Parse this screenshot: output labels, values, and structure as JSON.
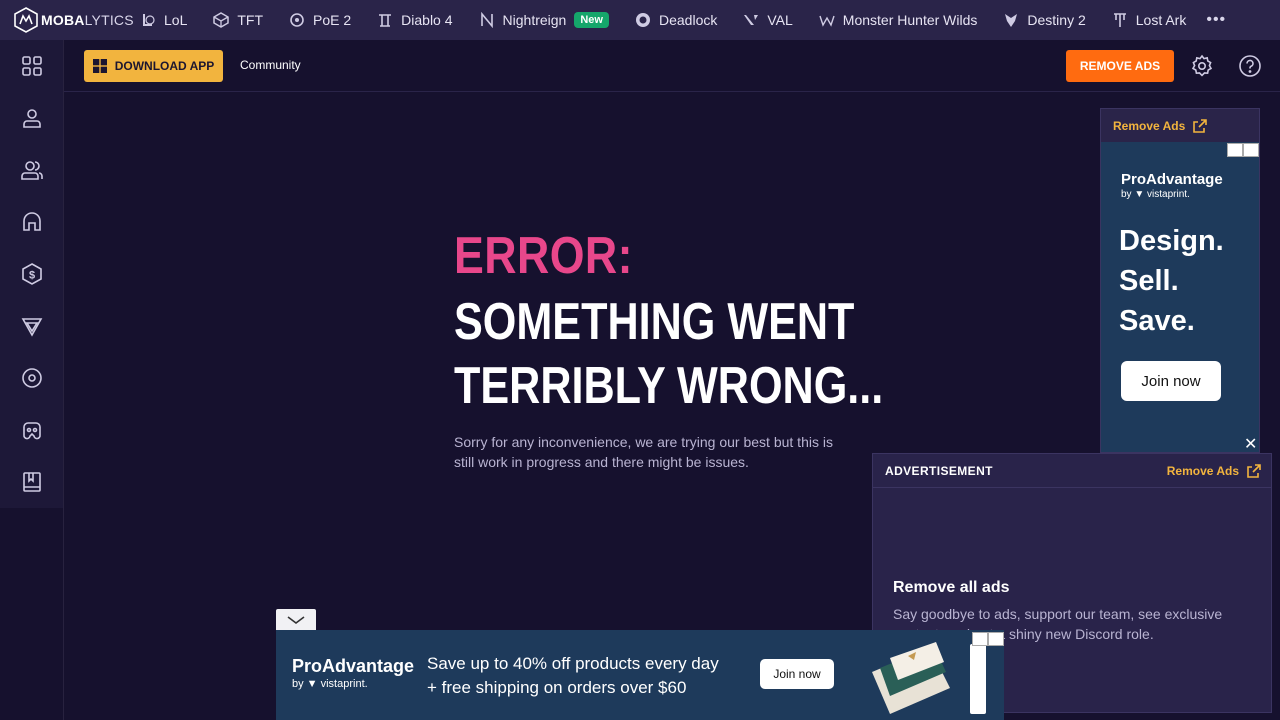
{
  "brand": {
    "logo_bold": "MOBA",
    "logo_thin": "LYTICS"
  },
  "games": [
    {
      "label": "LoL",
      "icon": "lol-icon"
    },
    {
      "label": "TFT",
      "icon": "tft-icon"
    },
    {
      "label": "PoE 2",
      "icon": "poe-icon"
    },
    {
      "label": "Diablo 4",
      "icon": "diablo-icon"
    },
    {
      "label": "Nightreign",
      "icon": "nightreign-icon",
      "badge": "New"
    },
    {
      "label": "Deadlock",
      "icon": "deadlock-icon"
    },
    {
      "label": "VAL",
      "icon": "valorant-icon"
    },
    {
      "label": "Monster Hunter Wilds",
      "icon": "monster-hunter-icon"
    },
    {
      "label": "Destiny 2",
      "icon": "destiny-icon"
    },
    {
      "label": "Lost Ark",
      "icon": "lost-ark-icon"
    }
  ],
  "more_label": "•••",
  "subheader": {
    "download_label": "DOWNLOAD APP",
    "community_label": "Community",
    "remove_ads_label": "REMOVE ADS"
  },
  "error": {
    "heading": "ERROR:",
    "line1": "SOMETHING WENT",
    "line2": "TERRIBLY WRONG...",
    "description": "Sorry for any inconvenience, we are trying our best but this is still work in progress and there might be issues."
  },
  "side_ad": {
    "remove_label": "Remove Ads",
    "brand": "ProAdvantage",
    "by": "by ▼ vistaprint.",
    "line1": "Design.",
    "line2": "Sell.",
    "line3": "Save.",
    "cta": "Join now"
  },
  "close_label": "✕",
  "ad_panel": {
    "label": "ADVERTISEMENT",
    "remove_label": "Remove Ads",
    "title": "Remove all ads",
    "text": "Say goodbye to ads, support our team, see exclusive content, and get a shiny new Discord role."
  },
  "banner": {
    "brand": "ProAdvantage",
    "by": "by ▼ vistaprint.",
    "line1": "Save up to 40% off products every day",
    "line2": "+ free shipping on orders over $60",
    "cta": "Join now"
  },
  "colors": {
    "background": "#16112e",
    "nav": "#2a2449",
    "accent_yellow": "#f2b43e",
    "accent_orange": "#ff6b10",
    "error_pink": "#e8478b",
    "ad_blue": "#1e3a5b"
  }
}
